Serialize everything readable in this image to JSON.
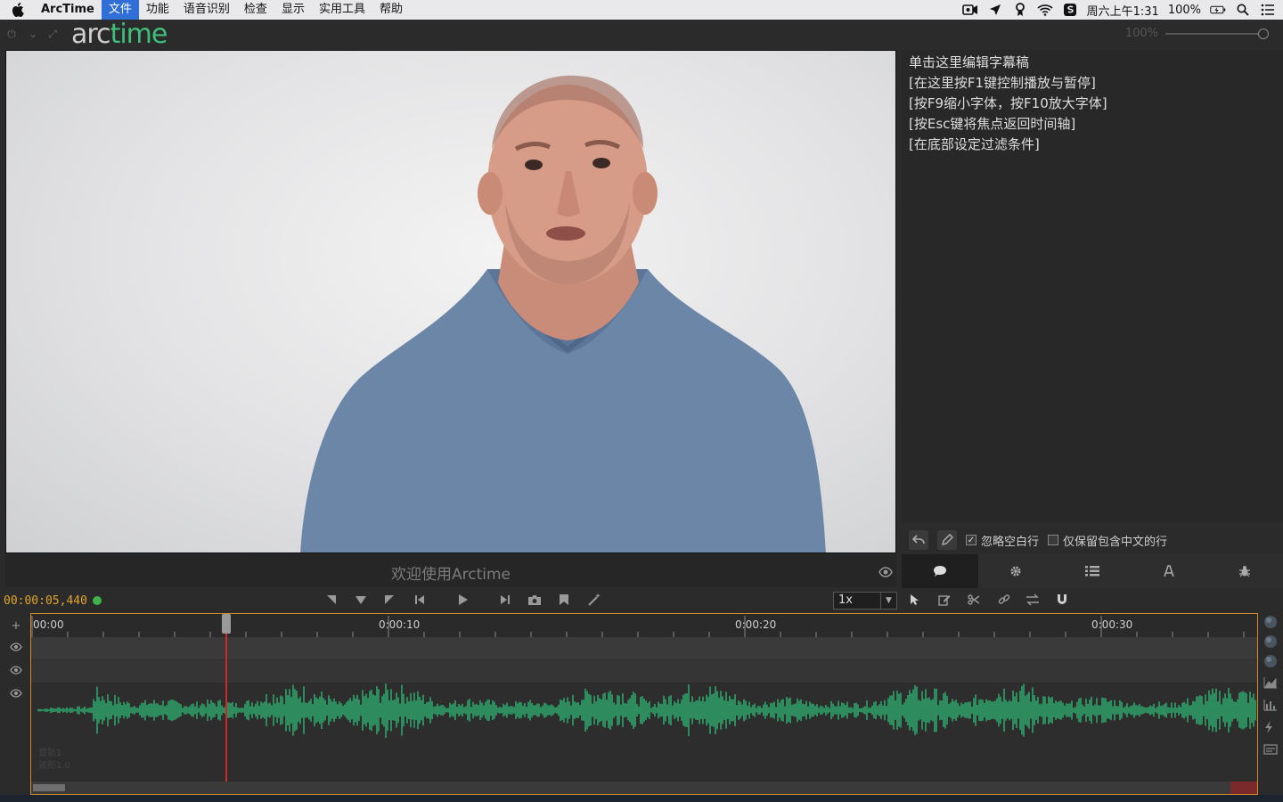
{
  "menubar": {
    "app_name": "ArcTime",
    "items": [
      "文件",
      "功能",
      "语音识别",
      "检查",
      "显示",
      "实用工具",
      "帮助"
    ],
    "active_item": "文件",
    "clock": "周六上午1:31",
    "battery": "100%"
  },
  "app": {
    "logo_part1": "arc",
    "logo_part2": "time",
    "zoom_percent": "100%"
  },
  "editor": {
    "lines": [
      "单击这里编辑字幕稿",
      "[在这里按F1键控制播放与暂停]",
      "[按F9缩小字体，按F10放大字体]",
      "[按Esc键将焦点返回时间轴]",
      "[在底部设定过滤条件]"
    ],
    "filter_ignore_empty": "忽略空白行",
    "filter_keep_chinese": "仅保留包含中文的行",
    "ignore_empty_checked": true,
    "keep_chinese_checked": false
  },
  "player": {
    "subtitle": "欢迎使用Arctime"
  },
  "transport": {
    "timecode": "00:00:05,440",
    "speed": "1x"
  },
  "timeline": {
    "ruler_labels": [
      "00:00",
      "0:00:10",
      "0:00:20",
      "0:00:30"
    ],
    "track_info_1": "音轨1",
    "track_info_2": "波形1.0",
    "playhead_seconds": 5.44,
    "visible_seconds": 34.4
  },
  "colors": {
    "accent": "#3fbf7a",
    "waveform": "#2fa36a",
    "playhead": "#d02828",
    "timecode": "#e0a42a",
    "selection": "#2f6fd6"
  }
}
